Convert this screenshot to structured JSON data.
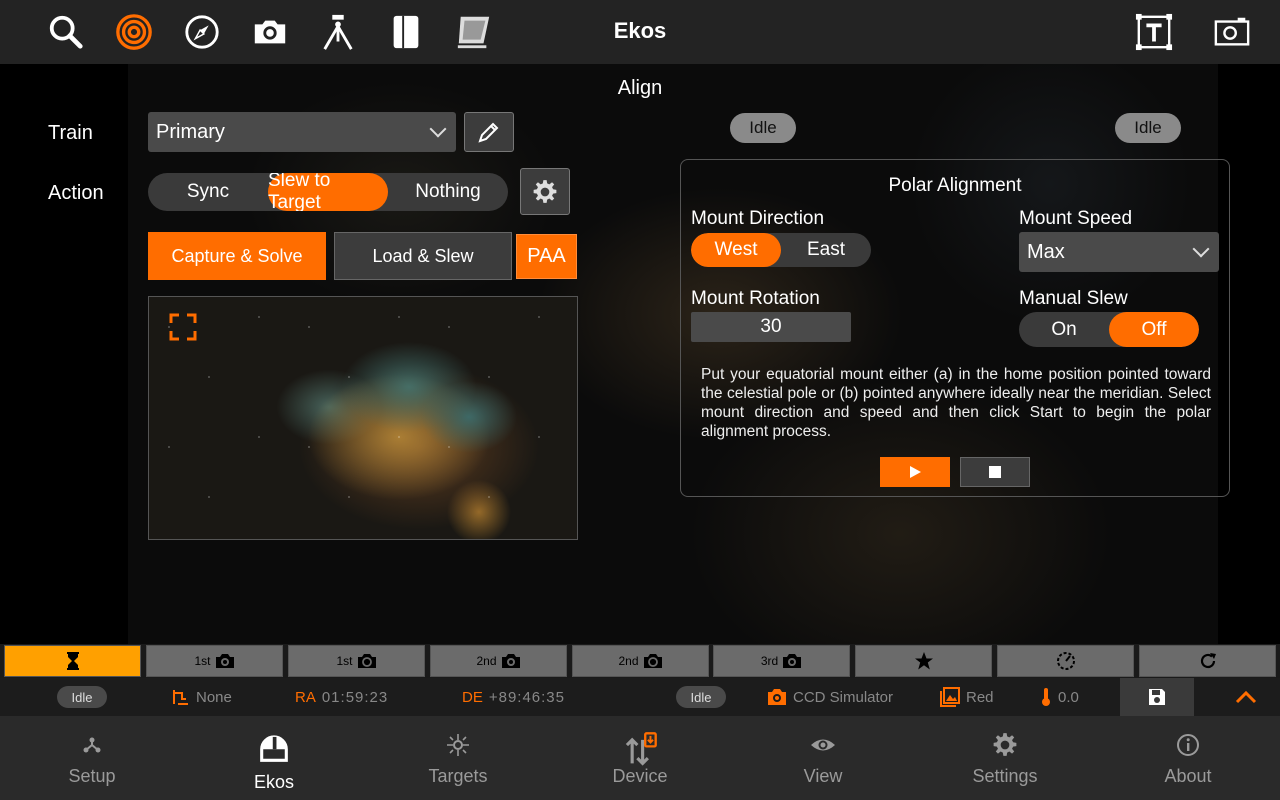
{
  "app": {
    "title": "Ekos",
    "top_icons": [
      "search-icon",
      "target-icon",
      "compass-icon",
      "camera-icon",
      "telescope-icon",
      "notebook-icon",
      "flat-panel-icon"
    ],
    "top_right_icons": [
      "text-frame-icon",
      "screenshot-icon"
    ]
  },
  "align": {
    "section_title": "Align",
    "train_label": "Train",
    "train_value": "Primary",
    "action_label": "Action",
    "actions": [
      "Sync",
      "Slew to Target",
      "Nothing"
    ],
    "active_action": "Slew to Target",
    "capture_solve": "Capture & Solve",
    "load_slew": "Load & Slew",
    "paa": "PAA",
    "status_left": "Idle",
    "status_right": "Idle"
  },
  "polar": {
    "title": "Polar Alignment",
    "mount_direction_label": "Mount Direction",
    "directions": [
      "West",
      "East"
    ],
    "active_direction": "West",
    "mount_speed_label": "Mount Speed",
    "mount_speed_value": "Max",
    "mount_rotation_label": "Mount Rotation",
    "mount_rotation_value": "30",
    "manual_slew_label": "Manual Slew",
    "manual_slew_options": [
      "On",
      "Off"
    ],
    "manual_slew_active": "Off",
    "instructions": "Put your equatorial mount either (a) in the home position pointed toward the celestial pole or (b) pointed anywhere ideally near the meridian. Select mount direction and speed and then click Start to begin the polar alignment process."
  },
  "modules": [
    {
      "label": "",
      "icon": "hourglass-icon",
      "active": true
    },
    {
      "label": "1st",
      "icon": "camera-icon"
    },
    {
      "label": "1st",
      "icon": "camera-refresh-icon"
    },
    {
      "label": "2nd",
      "icon": "camera-icon"
    },
    {
      "label": "2nd",
      "icon": "camera-refresh-icon"
    },
    {
      "label": "3rd",
      "icon": "camera-icon"
    },
    {
      "label": "",
      "icon": "star-icon"
    },
    {
      "label": "",
      "icon": "gauge-icon"
    },
    {
      "label": "",
      "icon": "refresh-icon"
    }
  ],
  "status": {
    "mount_state": "Idle",
    "target_label": "None",
    "ra_key": "RA",
    "ra_value": "01:59:23",
    "de_key": "DE",
    "de_value": "+89:46:35",
    "camera_state": "Idle",
    "camera_name": "CCD Simulator",
    "filter": "Red",
    "temperature": "0.0"
  },
  "nav": [
    "Setup",
    "Ekos",
    "Targets",
    "Device",
    "View",
    "Settings",
    "About"
  ],
  "nav_active": "Ekos",
  "colors": {
    "accent": "#ff6d00",
    "module_active": "#ffa000"
  }
}
